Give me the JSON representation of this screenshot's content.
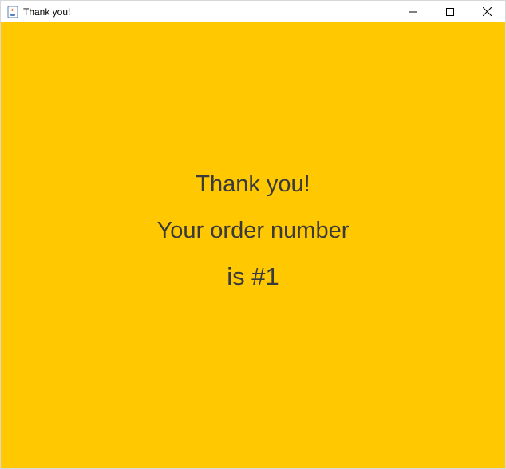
{
  "window": {
    "title": "Thank you!",
    "app_icon": "java-cup-icon",
    "controls": [
      "minimize-icon",
      "maximize-icon",
      "close-icon"
    ]
  },
  "message": {
    "line1": "Thank you!",
    "line2": "Your order number",
    "line3": "is #1"
  },
  "colors": {
    "background": "#ffc800",
    "text": "#3a3a3a"
  }
}
